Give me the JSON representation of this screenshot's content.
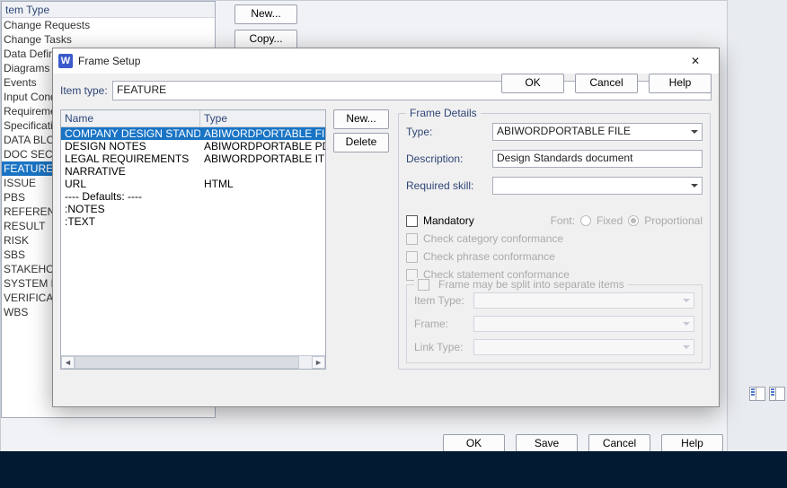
{
  "back": {
    "sidebar_header": "tem Type",
    "items": [
      "Change Requests",
      "Change Tasks",
      "Data Defini",
      "Diagrams",
      "Events",
      "Input Cond",
      "Requiremen",
      "Specification",
      "DATA BLOC",
      "DOC SECTIO",
      "FEATURE",
      "ISSUE",
      "PBS",
      "REFERENCE",
      "RESULT",
      "RISK",
      "SBS",
      "STAKEHOLD",
      "SYSTEM REQ",
      "VERIFICATIO",
      "WBS"
    ],
    "selected_index": 10,
    "buttons": {
      "new": "New...",
      "copy": "Copy..."
    },
    "footer": {
      "ok": "OK",
      "save": "Save",
      "cancel": "Cancel",
      "help": "Help"
    }
  },
  "dialog": {
    "title": "Frame Setup",
    "icon_letter": "W",
    "item_type_label": "Item type:",
    "item_type_value": "FEATURE",
    "grid": {
      "headers": {
        "name": "Name",
        "type": "Type"
      },
      "rows": [
        {
          "name": "COMPANY DESIGN STANDARD",
          "type": "ABIWORDPORTABLE FILE"
        },
        {
          "name": "DESIGN NOTES",
          "type": "ABIWORDPORTABLE PDB"
        },
        {
          "name": "LEGAL REQUIREMENTS",
          "type": "ABIWORDPORTABLE ITEM I"
        },
        {
          "name": "NARRATIVE",
          "type": ""
        },
        {
          "name": "URL",
          "type": "HTML"
        },
        {
          "name": "---- Defaults: ----",
          "type": ""
        },
        {
          "name": ":NOTES",
          "type": ""
        },
        {
          "name": ":TEXT",
          "type": ""
        }
      ],
      "selected_index": 0
    },
    "mid_buttons": {
      "new": "New...",
      "delete": "Delete"
    },
    "frame_details": {
      "legend": "Frame Details",
      "type_label": "Type:",
      "type_value": "ABIWORDPORTABLE FILE",
      "desc_label": "Description:",
      "desc_value": "Design Standards document",
      "skill_label": "Required skill:",
      "skill_value": "",
      "mandatory_label": "Mandatory",
      "font_label": "Font:",
      "font_fixed": "Fixed",
      "font_prop": "Proportional",
      "chk_cat": "Check category conformance",
      "chk_phrase": "Check phrase conformance",
      "chk_stmt": "Check statement conformance",
      "sub_legend": "Frame may be split into separate items",
      "sub_item": "Item Type:",
      "sub_frame": "Frame:",
      "sub_link": "Link Type:"
    },
    "footer": {
      "ok": "OK",
      "cancel": "Cancel",
      "help": "Help"
    }
  }
}
